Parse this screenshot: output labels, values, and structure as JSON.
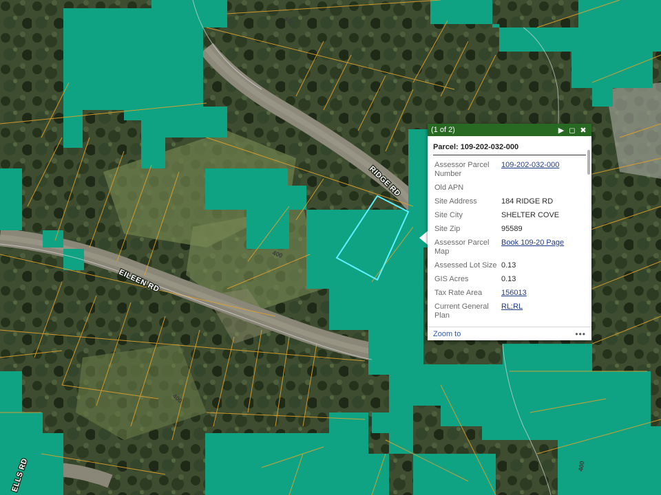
{
  "colors": {
    "imagery_base": "#3c4a2e",
    "parcel_fill": "#0fa383",
    "parcel_outline": "#e0a02c",
    "selected_outline": "#5ef0ff",
    "popup_header": "#286a22",
    "link": "#1f3b8c"
  },
  "map": {
    "road_labels": {
      "ridge": "RIDGE RD",
      "eileen": "EILEEN RD",
      "wells": "ELLS RD"
    },
    "route_labels": {
      "r1": "400",
      "r2": "400",
      "r3": "400",
      "r4": "400"
    }
  },
  "popup": {
    "count": "(1 of 2)",
    "title": "Parcel: 109-202-032-000",
    "zoom_to": "Zoom to",
    "more": "•••",
    "icons": {
      "next": "play-icon",
      "maximize": "maximize-icon",
      "close": "close-icon"
    },
    "fields": {
      "apn": {
        "label": "Assessor Parcel Number",
        "value": "109-202-032-000"
      },
      "old_apn": {
        "label": "Old APN",
        "value": ""
      },
      "address": {
        "label": "Site Address",
        "value": "184 RIDGE RD"
      },
      "city": {
        "label": "Site City",
        "value": "SHELTER COVE"
      },
      "zip": {
        "label": "Site Zip",
        "value": "95589"
      },
      "map": {
        "label": "Assessor Parcel Map",
        "value": "Book 109-20 Page"
      },
      "lot_size": {
        "label": "Assessed Lot Size",
        "value": "0.13"
      },
      "gis_acres": {
        "label": "GIS Acres",
        "value": "0.13"
      },
      "tax_rate": {
        "label": "Tax Rate Area",
        "value": "156013"
      },
      "gen_plan": {
        "label": "Current General Plan",
        "value": "RL;RL"
      }
    }
  }
}
